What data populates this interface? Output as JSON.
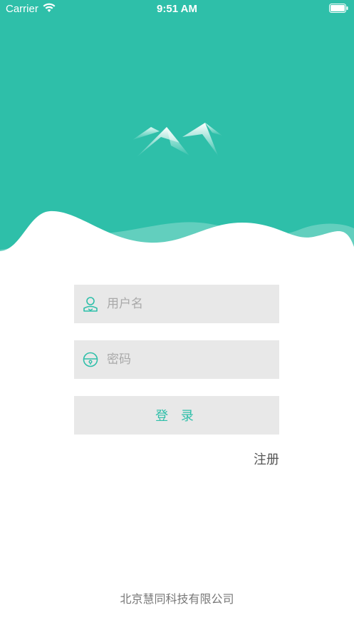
{
  "status_bar": {
    "carrier": "Carrier",
    "time": "9:51 AM",
    "wifi_icon": "wifi-icon",
    "battery_icon": "battery-icon"
  },
  "header": {
    "background_color": "#2ebfa9",
    "logo_icon": "mountain-logo-icon"
  },
  "form": {
    "username": {
      "icon": "user-icon",
      "placeholder": "用户名",
      "value": ""
    },
    "password": {
      "icon": "lock-icon",
      "placeholder": "密码",
      "value": ""
    },
    "login_label": "登 录",
    "register_label": "注册"
  },
  "footer": {
    "company": "北京慧同科技有限公司"
  },
  "colors": {
    "accent": "#2ebfa9",
    "field_bg": "#e8e8e8"
  }
}
